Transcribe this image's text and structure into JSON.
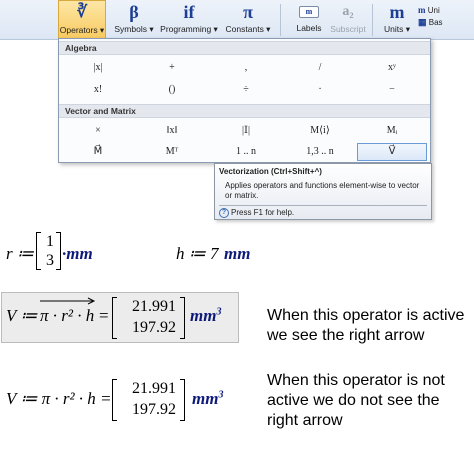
{
  "ribbon": {
    "items": [
      {
        "glyph": "∛",
        "label": "Operators ▾"
      },
      {
        "glyph": "β",
        "label": "Symbols ▾"
      },
      {
        "glyph": "if",
        "label": "Programming ▾"
      },
      {
        "glyph": "π",
        "label": "Constants ▾"
      }
    ],
    "labels_btn": "Labels",
    "subscript_btn": "Subscript",
    "subscript_glyph": "a₂",
    "units_glyph": "m",
    "units_btn": "Units ▾",
    "right_top": "Uni",
    "right_mid": "Bas"
  },
  "panel": {
    "algebra_title": "Algebra",
    "algebra_ops": [
      "|x|",
      "+",
      ",",
      "/",
      "xʸ",
      "x!",
      "()",
      "÷",
      "·",
      "−"
    ],
    "vector_title": "Vector and Matrix",
    "vector_ops": [
      "×",
      "‖x‖",
      "|𝕀|",
      "M⟨i⟩",
      "Mᵢ",
      "M⃗",
      "Mᵀ",
      "1 .. n",
      "1,3 .. n",
      "V⃗"
    ]
  },
  "tooltip": {
    "title": "Vectorization (Ctrl+Shift+^)",
    "body": "Applies operators and functions element-wise to vector or matrix.",
    "help": "Press F1 for help."
  },
  "worksheet": {
    "r_lhs": "r ≔",
    "r_values": [
      "1",
      "3"
    ],
    "r_unit": "·mm",
    "h_expr": "h ≔ 7",
    "h_unit": "mm",
    "v1_lhs": "V ≔",
    "v1_expr": "π · r² · h",
    "v1_eq": "=",
    "v1_values": [
      "21.991",
      "197.92"
    ],
    "v1_unit": "mm",
    "v1_unit_exp": "3",
    "v2_lhs": "V ≔ π · r² · h =",
    "v2_values": [
      "21.991",
      "197.92"
    ],
    "v2_unit": "mm",
    "v2_unit_exp": "3"
  },
  "notes": {
    "active_line1": "When this operator is active",
    "active_line2": "we see the right arrow",
    "inactive_line1": "When this operator is not",
    "inactive_line2": "active we do not see the",
    "inactive_line3": "right arrow"
  }
}
